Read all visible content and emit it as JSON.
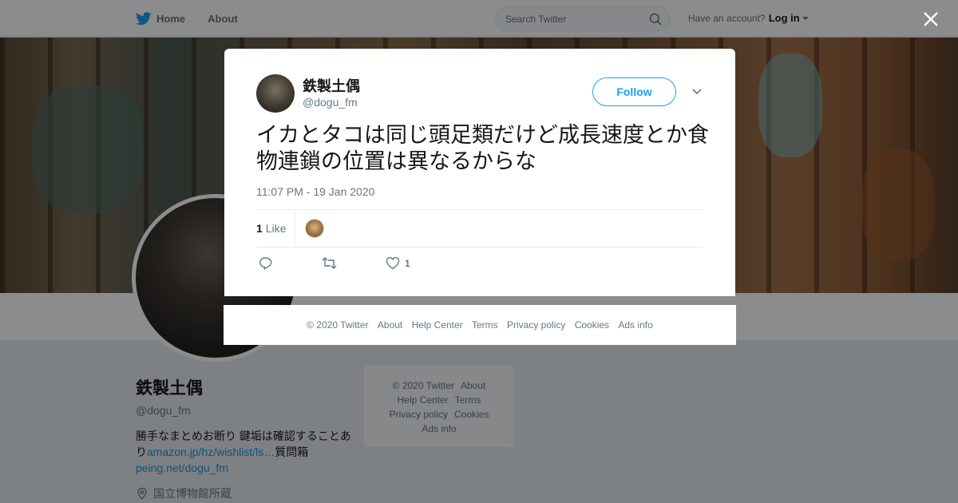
{
  "topbar": {
    "home_label": "Home",
    "about_label": "About",
    "search_placeholder": "Search Twitter",
    "have_account": "Have an account?",
    "login_label": "Log in"
  },
  "profile": {
    "name": "鉄製土偶",
    "handle": "@dogu_fm",
    "bio_text": "勝手なまとめお断り 鍵垢は確認することあり",
    "bio_link1": "amazon.jp/hz/wishlist/ls…",
    "bio_text2": "質問箱",
    "bio_link2": "peing.net/dogu_fm",
    "location": "国立博物館所蔵"
  },
  "side_footer": {
    "items": [
      "© 2020 Twitter",
      "About",
      "Help Center",
      "Terms",
      "Privacy policy",
      "Cookies",
      "Ads info"
    ]
  },
  "tweet": {
    "name": "鉄製土偶",
    "handle": "@dogu_fm",
    "follow_label": "Follow",
    "text": "イカとタコは同じ頭足類だけど成長速度とか食物連鎖の位置は異なるからな",
    "timestamp": "11:07 PM - 19 Jan 2020",
    "likes_count": "1",
    "likes_label": "Like",
    "like_action_count": "1"
  },
  "footer": {
    "items": [
      "© 2020 Twitter",
      "About",
      "Help Center",
      "Terms",
      "Privacy policy",
      "Cookies",
      "Ads info"
    ]
  },
  "colors": {
    "accent": "#1da1f2",
    "overlay": "rgba(0,0,0,0.45)"
  },
  "icons": [
    "twitter-bird-icon",
    "search-icon",
    "close-icon",
    "chevron-down-icon",
    "reply-icon",
    "retweet-icon",
    "heart-icon",
    "location-icon"
  ]
}
